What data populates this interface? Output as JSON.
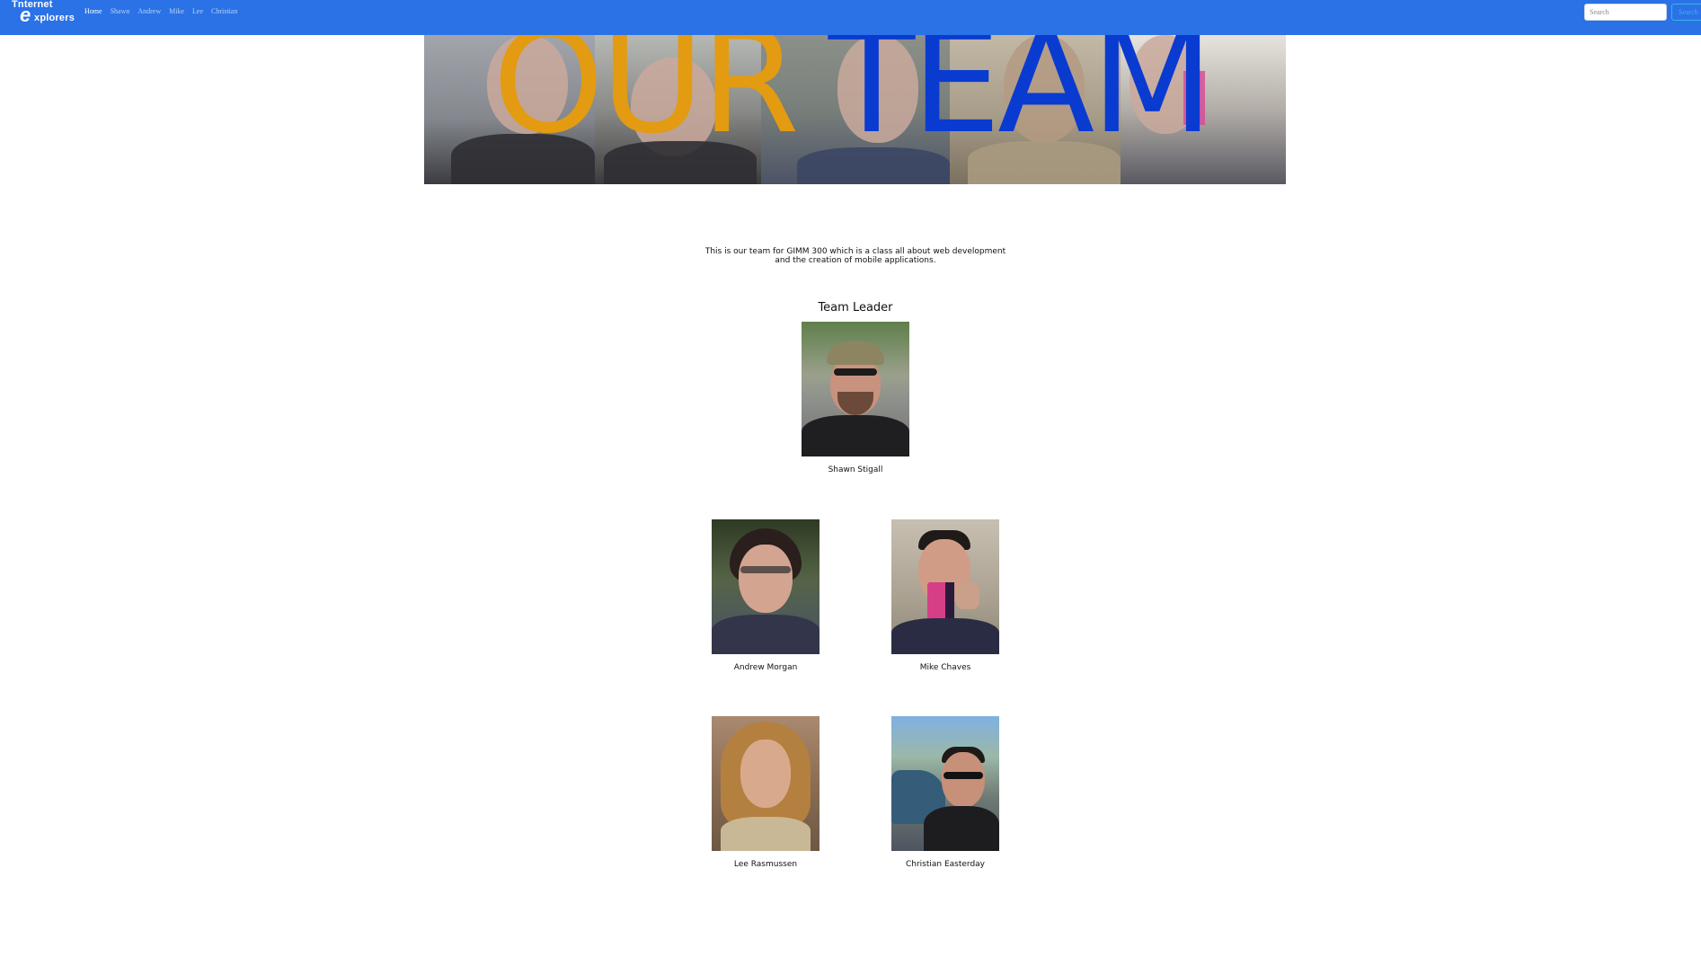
{
  "navbar": {
    "brand": {
      "line1": "Tnternet",
      "letter": "e",
      "line2": "xplorers"
    },
    "links": [
      {
        "label": "Home",
        "active": true
      },
      {
        "label": "Shawn",
        "active": false
      },
      {
        "label": "Andrew",
        "active": false
      },
      {
        "label": "Mike",
        "active": false
      },
      {
        "label": "Lee",
        "active": false
      },
      {
        "label": "Christian",
        "active": false
      }
    ],
    "search": {
      "placeholder": "Search",
      "button_label": "Search"
    }
  },
  "banner": {
    "word1": "OUR",
    "word2": "TEAM",
    "colors": {
      "word1": "#e39b12",
      "word2": "#0a3bd0"
    }
  },
  "intro": "This is our team for GIMM 300 which is a class all about web development and the creation of mobile applications.",
  "leader_heading": "Team Leader",
  "members": {
    "leader": {
      "name": "Shawn Stigall"
    },
    "andrew": {
      "name": "Andrew Morgan"
    },
    "mike": {
      "name": "Mike Chaves"
    },
    "lee": {
      "name": "Lee Rasmussen"
    },
    "christian": {
      "name": "Christian Easterday"
    }
  },
  "colors": {
    "navbar": "#2a72e6",
    "background": "#ffffff",
    "search_button": "#3bb3e8"
  }
}
